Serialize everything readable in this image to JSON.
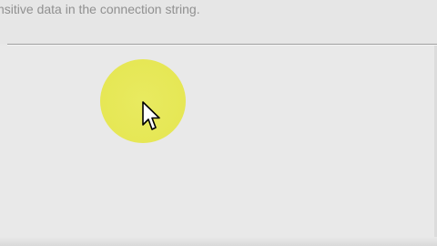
{
  "dialog": {
    "caption": "nsitive data in the connection string."
  },
  "overlay": {
    "highlight_color": "#e6e755",
    "cursor_icon": "arrow-cursor-icon"
  },
  "colors": {
    "background": "#e8e8e8",
    "text": "#909090",
    "divider": "#a0a0a0"
  }
}
